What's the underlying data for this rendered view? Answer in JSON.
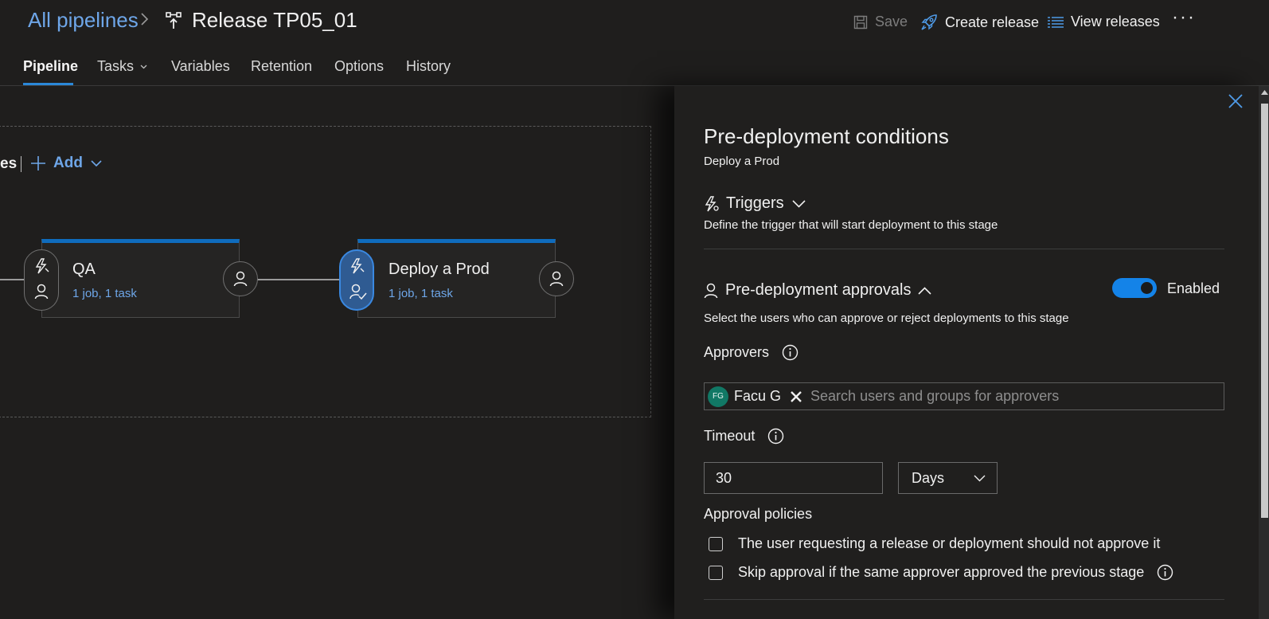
{
  "header": {
    "breadcrumb_root": "All pipelines",
    "title": "Release TP05_01",
    "actions": {
      "save": "Save",
      "create_release": "Create release",
      "view_releases": "View releases",
      "more": "···"
    }
  },
  "tabs": [
    {
      "label": "Pipeline",
      "active": true
    },
    {
      "label": "Tasks",
      "has_dropdown": true
    },
    {
      "label": "Variables"
    },
    {
      "label": "Retention"
    },
    {
      "label": "Options"
    },
    {
      "label": "History"
    }
  ],
  "canvas": {
    "stages_label_fragment": "es",
    "add_label": "Add",
    "stages": [
      {
        "name": "QA",
        "summary": "1 job, 1 task"
      },
      {
        "name": "Deploy a Prod",
        "summary": "1 job, 1 task",
        "selected": true
      }
    ]
  },
  "panel": {
    "title": "Pre-deployment conditions",
    "subtitle": "Deploy a Prod",
    "triggers": {
      "label": "Triggers",
      "description": "Define the trigger that will start deployment to this stage"
    },
    "approvals": {
      "label": "Pre-deployment approvals",
      "description": "Select the users who can approve or reject deployments to this stage",
      "toggle_label": "Enabled",
      "enabled": true,
      "approvers_label": "Approvers",
      "approver": {
        "initials": "FG",
        "name": "Facu G"
      },
      "search_placeholder": "Search users and groups for approvers",
      "timeout_label": "Timeout",
      "timeout_value": "30",
      "timeout_unit": "Days",
      "policies_label": "Approval policies",
      "policies": [
        {
          "label": "The user requesting a release or deployment should not approve it",
          "checked": false
        },
        {
          "label": "Skip approval if the same approver approved the previous stage",
          "checked": false
        }
      ]
    }
  },
  "colors": {
    "background": "#1f1e1d",
    "accent": "#0f6cbd",
    "link": "#6ea6e8",
    "toggle_on": "#1483e8",
    "avatar": "#117865"
  }
}
